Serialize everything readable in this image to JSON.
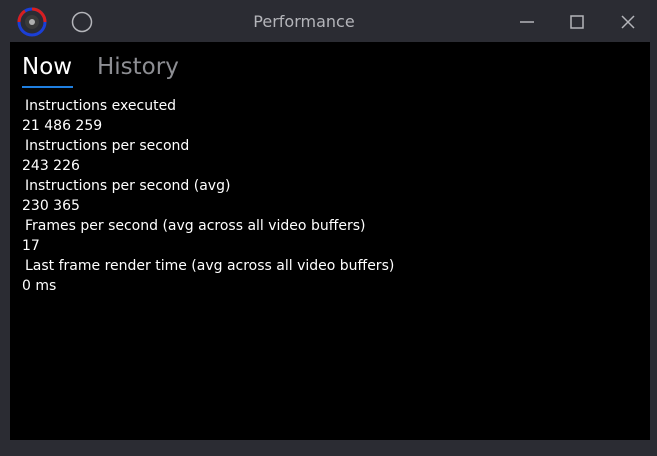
{
  "window": {
    "title": "Performance",
    "icons": {
      "app": "app-logo-icon",
      "pin": "circle-icon",
      "minimize": "minimize-icon",
      "maximize": "maximize-icon",
      "close": "close-icon"
    }
  },
  "tabs": [
    {
      "label": "Now",
      "active": true
    },
    {
      "label": "History",
      "active": false
    }
  ],
  "metrics": [
    {
      "label": "Instructions executed",
      "value": "21 486 259"
    },
    {
      "label": "Instructions per second",
      "value": "243 226"
    },
    {
      "label": "Instructions per second (avg)",
      "value": "230 365"
    },
    {
      "label": "Frames per second (avg across all video buffers)",
      "value": "17"
    },
    {
      "label": "Last frame render time (avg across all video buffers)",
      "value": "0 ms"
    }
  ],
  "colors": {
    "titlebar": "#2b2c33",
    "content": "#000000",
    "accent": "#1f7fe0",
    "inactive_tab": "#8d8e93"
  }
}
